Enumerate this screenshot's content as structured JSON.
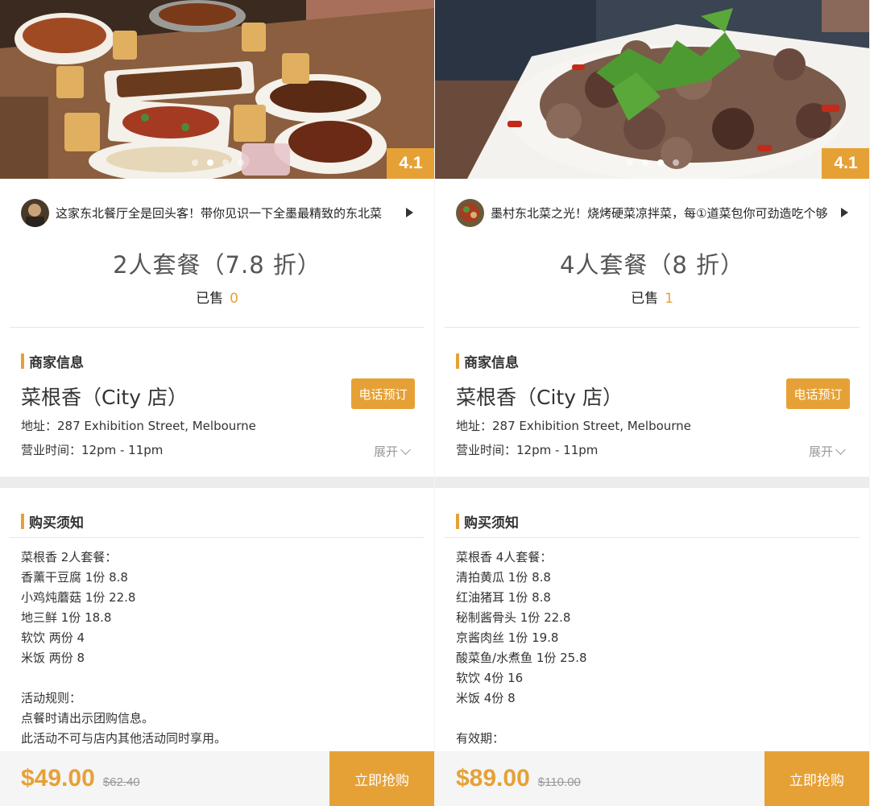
{
  "panels": [
    {
      "rating": "4.1",
      "note_text": "这家东北餐厅全是回头客！带你见识一下全墨最精致的东北菜",
      "deal_title": "2人套餐（7.8 折）",
      "sold_label": "已售",
      "sold_count": "0",
      "merchant_heading": "商家信息",
      "shop_name": "菜根香（City 店）",
      "call_button": "电话预订",
      "address": "地址：287 Exhibition Street, Melbourne",
      "hours": "营业时间：12pm - 11pm",
      "expand_label": "展开",
      "notice_heading": "购买须知",
      "notice_lines": [
        "菜根香 2人套餐：",
        "香薰干豆腐 1份  8.8",
        "小鸡炖蘑菇 1份  22.8",
        "地三鲜 1份  18.8",
        "软饮 两份  4",
        "米饭 两份  8",
        "",
        "活动规则：",
        "点餐时请出示团购信息。",
        "此活动不可与店内其他活动同时享用。"
      ],
      "price": "$49.00",
      "old_price": "$62.40",
      "buy_button": "立即抢购"
    },
    {
      "rating": "4.1",
      "note_text": "墨村东北菜之光！烧烤硬菜凉拌菜，每①道菜包你可劲造吃个够",
      "deal_title": "4人套餐（8 折）",
      "sold_label": "已售",
      "sold_count": "1",
      "merchant_heading": "商家信息",
      "shop_name": "菜根香（City 店）",
      "call_button": "电话预订",
      "address": "地址：287 Exhibition Street, Melbourne",
      "hours": "营业时间：12pm - 11pm",
      "expand_label": "展开",
      "notice_heading": "购买须知",
      "notice_lines": [
        "菜根香 4人套餐：",
        "清拍黄瓜 1份  8.8",
        "红油猪耳 1份  8.8",
        "秘制酱骨头 1份  22.8",
        "京酱肉丝 1份  19.8",
        "酸菜鱼/水煮鱼 1份  25.8",
        "软饮 4份  16",
        "米饭 4份  8",
        "",
        "有效期："
      ],
      "price": "$89.00",
      "old_price": "$110.00",
      "buy_button": "立即抢购"
    }
  ],
  "colors": {
    "accent": "#e6a136",
    "text": "#333333",
    "muted": "#999999"
  }
}
